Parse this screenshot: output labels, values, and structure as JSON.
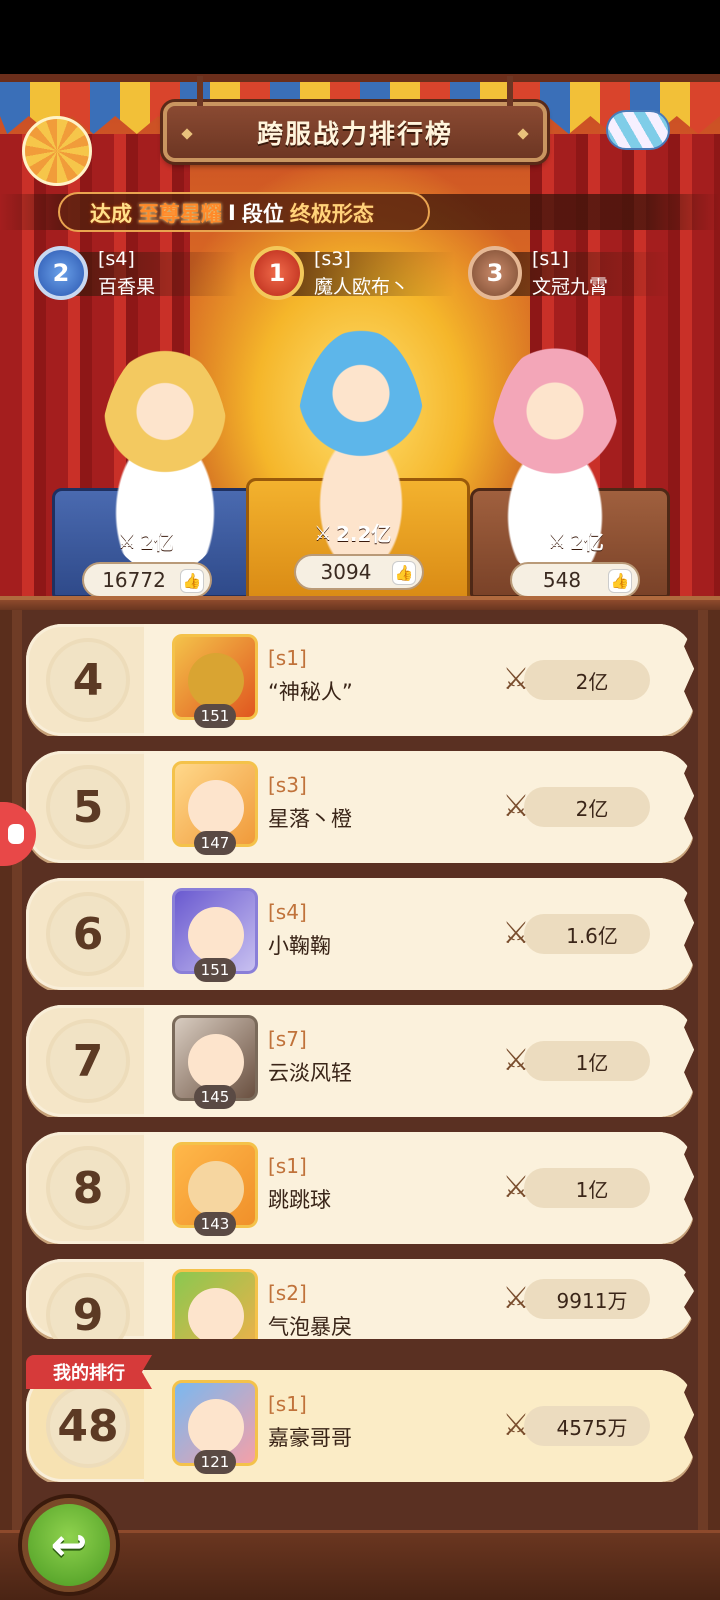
{
  "title": "跨服战力排行榜",
  "achievement": {
    "part1": "达成",
    "part2": "至尊星耀",
    "separator": "I",
    "part3": "段位",
    "part4": "终极形态"
  },
  "top3": [
    {
      "rank": "2",
      "server": "[s4]",
      "name": "百香果",
      "power": "2亿",
      "likes": "16772",
      "medal_color": "#2a56b0"
    },
    {
      "rank": "1",
      "server": "[s3]",
      "name": "魔人欧布丶",
      "power": "2.2亿",
      "likes": "3094",
      "medal_color": "#b82818"
    },
    {
      "rank": "3",
      "server": "[s1]",
      "name": "文冠九霄",
      "power": "2亿",
      "likes": "548",
      "medal_color": "#7a4a30"
    }
  ],
  "ranking": [
    {
      "rank": "4",
      "server": "[s1]",
      "name": "“神秘人”",
      "level": "151",
      "power": "2亿"
    },
    {
      "rank": "5",
      "server": "[s3]",
      "name": "星落丶橙",
      "level": "147",
      "power": "2亿"
    },
    {
      "rank": "6",
      "server": "[s4]",
      "name": "小鞠鞠",
      "level": "151",
      "power": "1.6亿"
    },
    {
      "rank": "7",
      "server": "[s7]",
      "name": "云淡风轻",
      "level": "145",
      "power": "1亿"
    },
    {
      "rank": "8",
      "server": "[s1]",
      "name": "跳跳球",
      "level": "143",
      "power": "1亿"
    },
    {
      "rank": "9",
      "server": "[s2]",
      "name": "气泡暴戾",
      "level": "",
      "power": "9911万"
    }
  ],
  "my_rank": {
    "label": "我的排行",
    "rank": "48",
    "server": "[s1]",
    "name": "嘉豪哥哥",
    "level": "121",
    "power": "4575万"
  },
  "icons": {
    "power": "crossed-swords-icon",
    "like": "thumbs-up-icon",
    "back": "back-arrow-icon"
  },
  "colors": {
    "rank_accent": "#d63a3a",
    "server_text": "#c0723a",
    "back_button": "#4a9a22"
  }
}
